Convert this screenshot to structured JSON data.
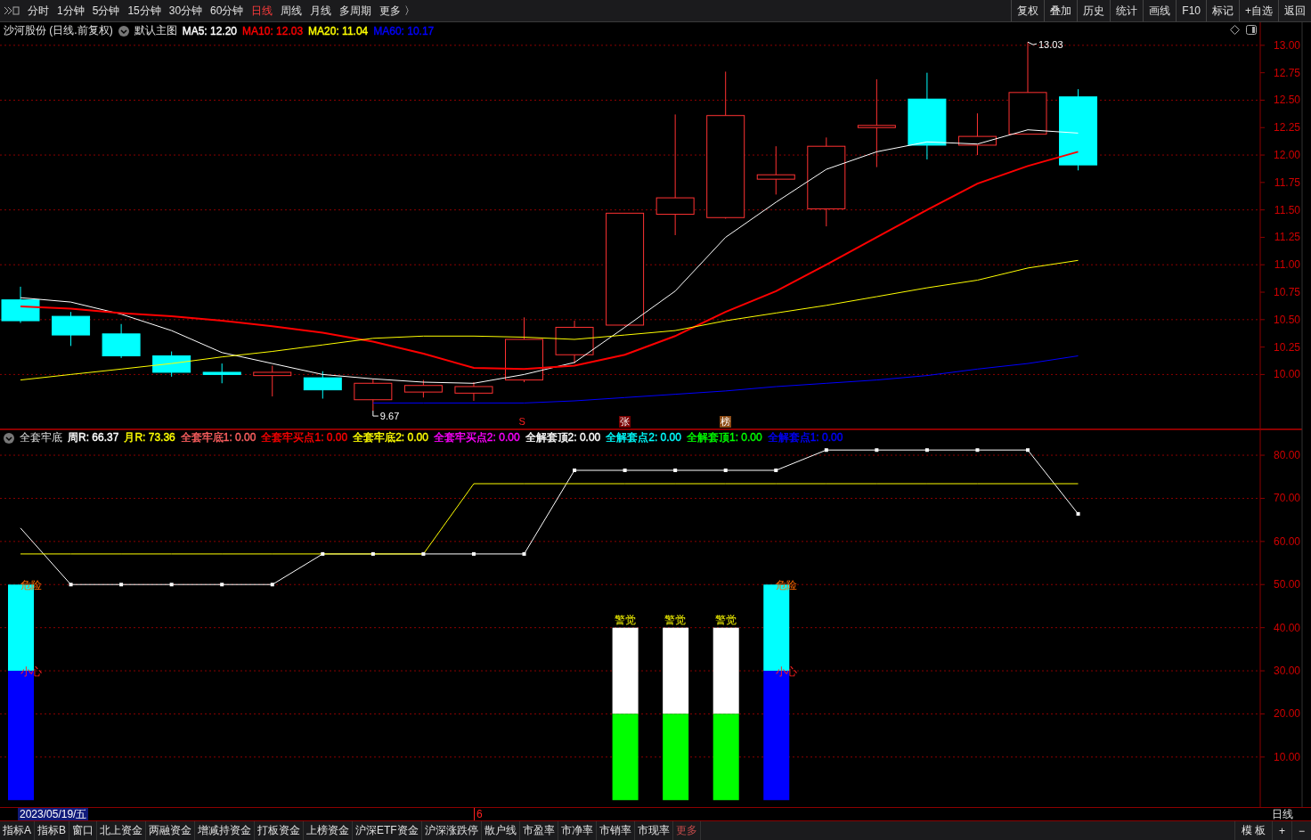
{
  "toolbar": {
    "periods": [
      {
        "label": "分时",
        "selected": false
      },
      {
        "label": "1分钟",
        "selected": false
      },
      {
        "label": "5分钟",
        "selected": false
      },
      {
        "label": "15分钟",
        "selected": false
      },
      {
        "label": "30分钟",
        "selected": false
      },
      {
        "label": "60分钟",
        "selected": false
      },
      {
        "label": "日线",
        "selected": true
      },
      {
        "label": "周线",
        "selected": false
      },
      {
        "label": "月线",
        "selected": false
      },
      {
        "label": "多周期",
        "selected": false
      }
    ],
    "more": "更多 〉",
    "buttons": [
      "复权",
      "叠加",
      "历史",
      "统计",
      "画线",
      "F10",
      "标记",
      "+自选",
      "返回"
    ]
  },
  "main_chart": {
    "legend": {
      "title": "沙河股份 (日线.前复权)",
      "template": "默认主图",
      "items": [
        {
          "label": "MA5: 12.20",
          "color": "#ffffff"
        },
        {
          "label": "MA10: 12.03",
          "color": "#ff0000"
        },
        {
          "label": "MA20: 11.04",
          "color": "#ffff00"
        },
        {
          "label": "MA60: 10.17",
          "color": "#0000ff"
        }
      ]
    },
    "chart_data": {
      "type": "line",
      "grid": true,
      "ylim": [
        9.5,
        13.21
      ],
      "yticks": [
        {
          "value": 13,
          "label": "13.00"
        },
        {
          "value": 12.75,
          "label": "12.75"
        },
        {
          "value": 12.5,
          "label": "12.50"
        },
        {
          "value": 12.25,
          "label": "12.25"
        },
        {
          "value": 12,
          "label": "12.00"
        },
        {
          "value": 11.75,
          "label": "11.75"
        },
        {
          "value": 11.5,
          "label": "11.50"
        },
        {
          "value": 11.25,
          "label": "11.25"
        },
        {
          "value": 11,
          "label": "11.00"
        },
        {
          "value": 10.75,
          "label": "10.75"
        },
        {
          "value": 10.5,
          "label": "10.50"
        },
        {
          "value": 10.25,
          "label": "10.25"
        },
        {
          "value": 10,
          "label": "10.00"
        }
      ],
      "series": [
        {
          "color": "#ffffff",
          "values": [
            10.7,
            10.66,
            10.55,
            10.4,
            10.2,
            10.1,
            10.0,
            9.96,
            9.93,
            9.92,
            10.0,
            10.11,
            10.43,
            10.76,
            11.25,
            11.57,
            11.87,
            12.03,
            12.12,
            12.1,
            12.23,
            12.2
          ]
        },
        {
          "color": "#ff0000",
          "values": [
            10.62,
            10.6,
            10.56,
            10.53,
            10.49,
            10.44,
            10.38,
            10.3,
            10.19,
            10.06,
            10.05,
            10.08,
            10.18,
            10.35,
            10.57,
            10.76,
            11.0,
            11.25,
            11.5,
            11.74,
            11.9,
            12.03
          ]
        },
        {
          "color": "#ffff00",
          "values": [
            9.95,
            10.0,
            10.05,
            10.1,
            10.16,
            10.21,
            10.27,
            10.33,
            10.35,
            10.35,
            10.34,
            10.32,
            10.36,
            10.4,
            10.49,
            10.56,
            10.63,
            10.71,
            10.79,
            10.86,
            10.97,
            11.04
          ]
        },
        {
          "color": "#0000ff",
          "values": [
            null,
            null,
            null,
            null,
            null,
            null,
            null,
            9.74,
            9.74,
            9.74,
            9.74,
            9.76,
            9.79,
            9.82,
            9.85,
            9.89,
            9.92,
            9.95,
            9.99,
            10.05,
            10.1,
            10.17
          ]
        }
      ]
    },
    "price_labels": [
      "13.03",
      "9.67"
    ],
    "markers": [
      {
        "text": "S",
        "kind": "signal"
      },
      {
        "text": "张",
        "kind": "zhang"
      },
      {
        "text": "榜",
        "kind": "bang"
      }
    ]
  },
  "indicator": {
    "legend": {
      "title": "全套牢底",
      "items": [
        {
          "label": "周R: 66.37",
          "color": "#ffffff"
        },
        {
          "label": "月R: 73.36",
          "color": "#ffff00"
        },
        {
          "label": "全套牢底1: 0.00",
          "color": "#ff6060"
        },
        {
          "label": "全套牢买点1: 0.00",
          "color": "#ff0000"
        },
        {
          "label": "全套牢底2: 0.00",
          "color": "#ffff00"
        },
        {
          "label": "全套牢买点2: 0.00",
          "color": "#ff00ff"
        },
        {
          "label": "全解套顶2: 0.00",
          "color": "#ffffff"
        },
        {
          "label": "全解套点2: 0.00",
          "color": "#00ffff"
        },
        {
          "label": "全解套顶1: 0.00",
          "color": "#00ff00"
        },
        {
          "label": "全解套点1: 0.00",
          "color": "#0000ff"
        }
      ]
    },
    "chart_data": {
      "type": "line",
      "grid": true,
      "ylim": [
        -1.6,
        86
      ],
      "yticks": [
        {
          "value": 80,
          "label": "80.00"
        },
        {
          "value": 70,
          "label": "70.00"
        },
        {
          "value": 60,
          "label": "60.00"
        },
        {
          "value": 50,
          "label": "50.00"
        },
        {
          "value": 40,
          "label": "40.00"
        },
        {
          "value": 30,
          "label": "30.00"
        },
        {
          "value": 20,
          "label": "20.00"
        },
        {
          "value": 10,
          "label": "10.00"
        }
      ],
      "series": [
        {
          "color": "#ffffff",
          "marker": true,
          "values": [
            63.1,
            50,
            50,
            50,
            50,
            50,
            57.1,
            57.1,
            57.1,
            57.1,
            57.1,
            76.5,
            76.5,
            76.5,
            76.5,
            76.5,
            81.2,
            81.2,
            81.2,
            81.2,
            81.2,
            66.4
          ]
        },
        {
          "color": "#ffff00",
          "values": [
            57.1,
            57.1,
            57.1,
            57.1,
            57.1,
            57.1,
            57.1,
            57.1,
            57.1,
            73.4,
            73.4,
            73.4,
            73.4,
            73.4,
            73.4,
            73.4,
            73.4,
            73.4,
            73.4,
            73.4,
            73.4,
            73.4
          ]
        }
      ]
    },
    "signals": [
      {
        "kind": "danger",
        "labels": [
          "危险",
          "小心"
        ]
      },
      {
        "kind": "alert",
        "labels": [
          "警觉"
        ]
      },
      {
        "kind": "alert",
        "labels": [
          "警觉"
        ]
      },
      {
        "kind": "alert",
        "labels": [
          "警觉"
        ]
      },
      {
        "kind": "danger",
        "labels": [
          "危险",
          "小心"
        ]
      }
    ]
  },
  "date_strip": {
    "date": "2023/05/19/五",
    "marker": "6",
    "period": "日线"
  },
  "bottom_tabs": [
    {
      "label": "指标A",
      "kind": "tab"
    },
    {
      "label": "指标B",
      "kind": "tab"
    },
    {
      "label": "窗口",
      "kind": "tab"
    },
    {
      "label": "北上资金",
      "kind": "tab"
    },
    {
      "label": "两融资金",
      "kind": "tab"
    },
    {
      "label": "增减持资金",
      "kind": "tab"
    },
    {
      "label": "打板资金",
      "kind": "tab"
    },
    {
      "label": "上榜资金",
      "kind": "tab"
    },
    {
      "label": "沪深ETF资金",
      "kind": "tab"
    },
    {
      "label": "沪深涨跌停",
      "kind": "tab"
    },
    {
      "label": "散户线",
      "kind": "tab"
    },
    {
      "label": "市盈率",
      "kind": "tab"
    },
    {
      "label": "市净率",
      "kind": "tab"
    },
    {
      "label": "市销率",
      "kind": "tab"
    },
    {
      "label": "市现率",
      "kind": "tab"
    },
    {
      "label": "更多",
      "kind": "more"
    }
  ],
  "bottom_right": [
    "模 板",
    "+",
    "−"
  ]
}
